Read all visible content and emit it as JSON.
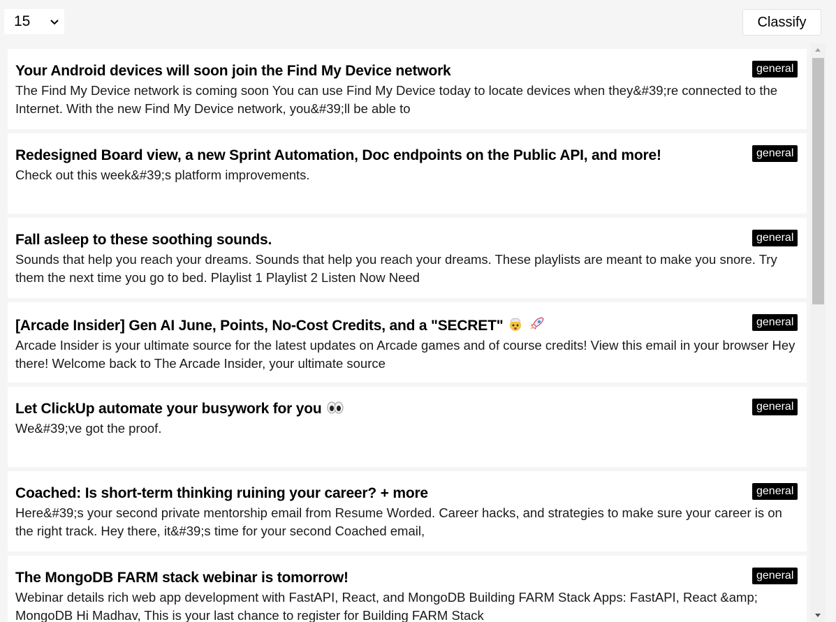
{
  "toolbar": {
    "count_value": "15",
    "classify_label": "Classify"
  },
  "emails": [
    {
      "title": "Your Android devices will soon join the Find My Device network",
      "snippet": "The Find My Device network is coming soon You can use Find My Device today to locate devices when they&#39;re connected to the Internet. With the new Find My Device network, you&#39;ll be able to",
      "label": "general"
    },
    {
      "title": "Redesigned Board view, a new Sprint Automation, Doc endpoints on the Public API, and more!",
      "snippet": "Check out this week&#39;s platform improvements.",
      "label": "general"
    },
    {
      "title": "Fall asleep to these soothing sounds.",
      "snippet": "Sounds that help you reach your dreams. Sounds that help you reach your dreams. These playlists are meant to make you snore. Try them the next time you go to bed. Playlist 1 Playlist 2 Listen Now Need",
      "label": "general"
    },
    {
      "title": "[Arcade Insider] Gen AI June, Points, No-Cost Credits, and a \"SECRET\"",
      "title_icons": [
        "exploding-head-emoji-icon",
        "rocket-emoji-icon"
      ],
      "snippet": "Arcade Insider is your ultimate source for the latest updates on Arcade games and of course credits! View this email in your browser Hey there! Welcome back to The Arcade Insider, your ultimate source",
      "label": "general"
    },
    {
      "title": "Let ClickUp automate your busywork for you",
      "title_icons": [
        "eyes-emoji-icon"
      ],
      "snippet": "We&#39;ve got the proof.",
      "label": "general"
    },
    {
      "title": "Coached: Is short-term thinking ruining your career? + more",
      "snippet": "Here&#39;s your second private mentorship email from Resume Worded. Career hacks, and strategies to make sure your career is on the right track. Hey there, it&#39;s time for your second Coached email,",
      "label": "general"
    },
    {
      "title": "The MongoDB FARM stack webinar is tomorrow!",
      "snippet": "Webinar details rich web app development with FastAPI, React, and MongoDB Building FARM Stack Apps: FastAPI, React &amp; MongoDB Hi Madhav, This is your last chance to register for Building FARM Stack",
      "label": "general"
    }
  ],
  "colors": {
    "background": "#f5f5f5",
    "card": "#ffffff",
    "badge_bg": "#000000",
    "badge_text": "#ffffff",
    "scroll_thumb": "#c1c1c1"
  }
}
